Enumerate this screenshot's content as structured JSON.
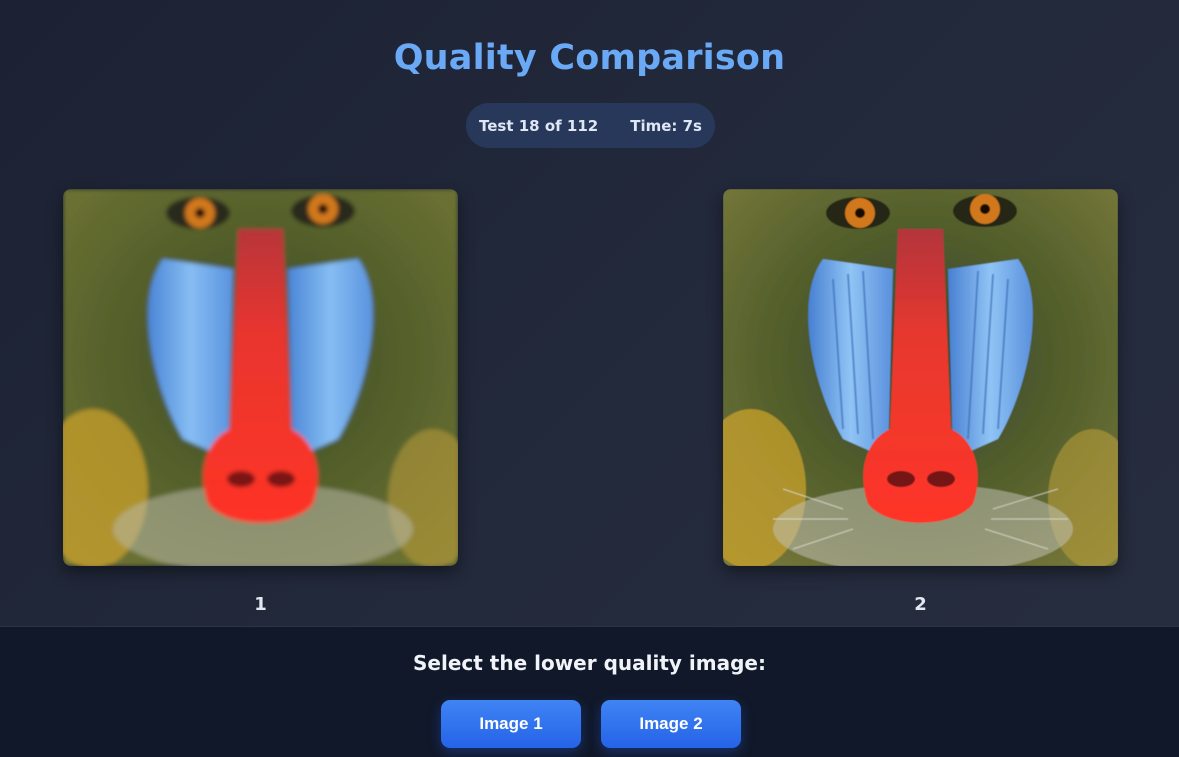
{
  "header": {
    "title": "Quality Comparison",
    "test_progress": "Test 18 of 112",
    "timer": "Time: 7s"
  },
  "images": [
    {
      "caption": "1",
      "alt": "mandrill-face-image"
    },
    {
      "caption": "2",
      "alt": "mandrill-face-image"
    }
  ],
  "footer": {
    "prompt": "Select the lower quality image:",
    "buttons": [
      "Image 1",
      "Image 2"
    ]
  },
  "colors": {
    "accent": "#6aa9f5",
    "button": "#2f6ff0",
    "nose_red": "#ee2a2a",
    "cheek_blue": "#6aaaf0",
    "fur_green": "#4e5a2a"
  }
}
